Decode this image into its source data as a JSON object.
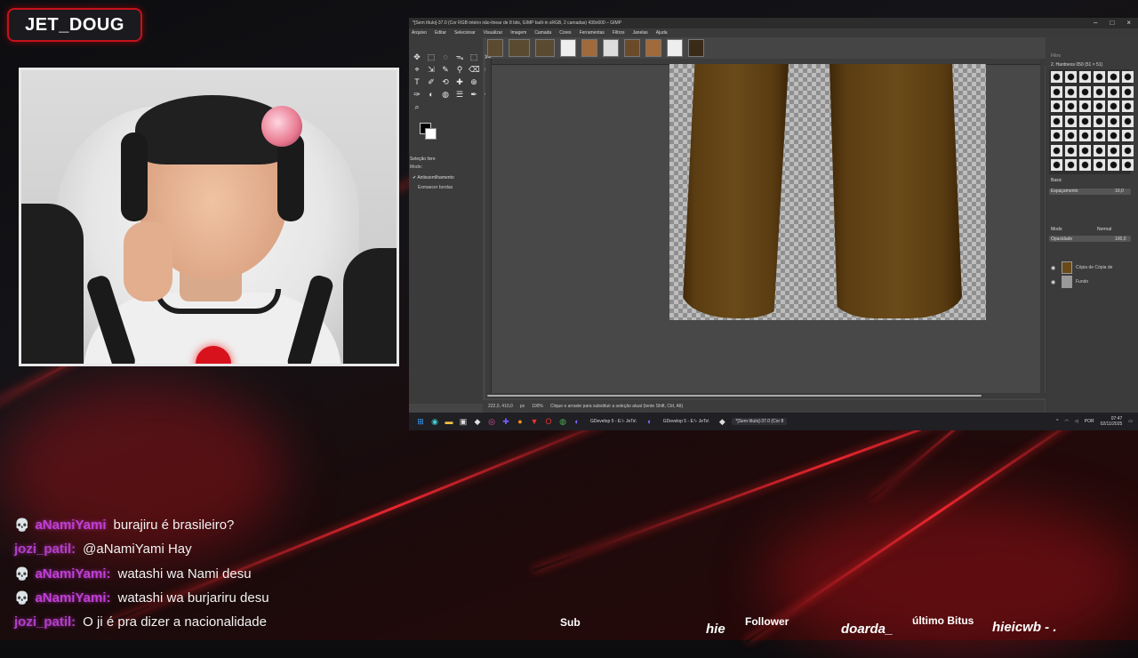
{
  "overlay": {
    "streamer_name": "JET_DOUG"
  },
  "gimp": {
    "title": "*[Sem título]-37.0 (Cor RGB inteiro não-linear de 8 bits, GIMP built-in sRGB, 2 camadas) 439x600 – GIMP",
    "window_buttons": [
      "–",
      "□",
      "×"
    ],
    "menu": [
      "Arquivo",
      "Editar",
      "Selecionar",
      "Visualizar",
      "Imagem",
      "Camada",
      "Cores",
      "Ferramentas",
      "Filtros",
      "Janelas",
      "Ajuda"
    ],
    "tool_icons": [
      "✥",
      "⬚",
      "◌",
      "ᯓ",
      "⬚",
      "✂",
      "⌖",
      "⇲",
      "✎",
      "⚲",
      "⌫",
      "⌬",
      "T",
      "✐",
      "⟲",
      "✚",
      "⊕",
      "⌀",
      "✑",
      "◐",
      "◍",
      "☰",
      "✒",
      "✏",
      "⌕"
    ],
    "tool_options": {
      "title": "Seleção livre",
      "mode_label": "Modo:",
      "antialias_label": "Antisserrilhamento",
      "feather_label": "Esmaecer bordas"
    },
    "status": {
      "coords": "222,0, 410,0",
      "unit": "px",
      "zoom": "100%",
      "message": "Clique e arraste para substituir a seleção atual (tente Shift, Ctrl, Alt)"
    },
    "right_panel": {
      "filter_placeholder": "Filtro",
      "brush_name": "2. Hardness 050 (51 × 51)",
      "preset": "Basic",
      "spacing_label": "Espaçamento",
      "spacing_value": "10,0",
      "mode_label": "Modo",
      "mode_value": "Normal",
      "opacity_label": "Opacidade",
      "opacity_value": "100,0",
      "layers": [
        {
          "name": "Cópia de Cópia de"
        },
        {
          "name": "Fundo"
        }
      ]
    },
    "taskbar": {
      "apps": [
        "GDevelop 5 - E:\\- JeTs\\",
        "GDevelop 5 - E:\\- JeTs\\",
        "*[Sem título]-37.0 (Cor 8"
      ],
      "lang": "POR",
      "time": "07:47",
      "date": "02/11/2025"
    }
  },
  "chat": [
    {
      "user": "aNamiYami",
      "text": "burajiru é brasileiro?",
      "icon": "skull-icon",
      "icon_glyph": "💀",
      "color": "#c040d6"
    },
    {
      "user": "jozi_patil:",
      "text": "@aNamiYami Hay",
      "icon": "",
      "icon_glyph": "",
      "color": "#b040c8"
    },
    {
      "user": "aNamiYami:",
      "text": "watashi wa Nami desu",
      "icon": "skull-icon",
      "icon_glyph": "💀",
      "color": "#c040d6"
    },
    {
      "user": "aNamiYami:",
      "text": "watashi wa burjariru desu",
      "icon": "skull-icon",
      "icon_glyph": "💀",
      "color": "#c040d6"
    },
    {
      "user": "jozi_patil:",
      "text": "O ji é pra dizer a nacionalidade",
      "icon": "",
      "icon_glyph": "",
      "color": "#b040c8"
    }
  ],
  "ticker": {
    "sub_label": "Sub",
    "sub_name": "hie",
    "follower_label": "Follower",
    "follower_name": "doarda_",
    "bits_label": "último Bitus",
    "bits_name": "hieicwb - ."
  }
}
